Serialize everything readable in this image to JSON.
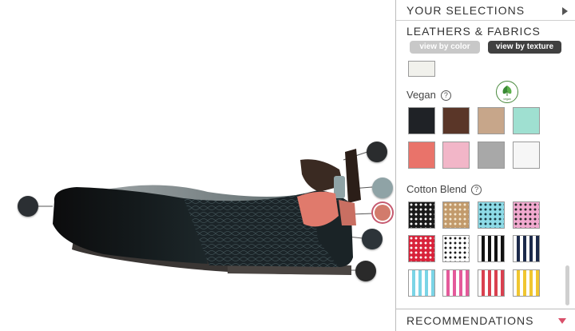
{
  "panel": {
    "selections_label": "YOUR SELECTIONS",
    "leathers_title": "LEATHERS & FABRICS",
    "view_by_color": "view by color",
    "view_by_texture": "view by texture",
    "recommendations_label": "RECOMMENDATIONS",
    "vegan_badge_label": "vegan",
    "groups": {
      "vegan": "Vegan",
      "cotton": "Cotton Blend"
    }
  },
  "hotspots": [
    {
      "name": "hotspot-toe",
      "color": "#2b2f33"
    },
    {
      "name": "hotspot-bow-top",
      "color": "#2a2c2e"
    },
    {
      "name": "hotspot-bow-band",
      "color": "#8fa3a6"
    },
    {
      "name": "hotspot-bow-lining",
      "color": "#d27b6c"
    },
    {
      "name": "hotspot-heel-counter",
      "color": "#2d3439"
    },
    {
      "name": "hotspot-sole",
      "color": "#2a2a2a"
    }
  ],
  "swatches": {
    "partial_top": {
      "color": "#f1f1ec"
    },
    "vegan": [
      "#1f2226",
      "#5a3628",
      "#c7a68a",
      "#9fe0d1",
      "#e9736a",
      "#f2b6c8",
      "#a8a8a8",
      "#f6f6f6"
    ],
    "cotton": [
      {
        "pattern": "dots",
        "base": "#1a1a1a",
        "dot": "#ffffff"
      },
      {
        "pattern": "dots",
        "base": "#c29a6b",
        "dot": "#f4e8d2"
      },
      {
        "pattern": "dots",
        "base": "#8ddbe7",
        "dot": "#1a3a44"
      },
      {
        "pattern": "dots",
        "base": "#f1a9cf",
        "dot": "#2a2a2a"
      },
      {
        "pattern": "dots",
        "base": "#d8223a",
        "dot": "#ffffff"
      },
      {
        "pattern": "dots",
        "base": "#ffffff",
        "dot": "#1a1a1a"
      },
      {
        "pattern": "stripes",
        "a": "#ffffff",
        "b": "#111111"
      },
      {
        "pattern": "stripes",
        "a": "#ffffff",
        "b": "#1c2a4a"
      },
      {
        "pattern": "stripes",
        "a": "#ffffff",
        "b": "#7ad4e6"
      },
      {
        "pattern": "stripes",
        "a": "#ffffff",
        "b": "#e45a9a"
      },
      {
        "pattern": "stripes",
        "a": "#ffffff",
        "b": "#d9404f"
      },
      {
        "pattern": "stripes",
        "a": "#ffffff",
        "b": "#f0c630"
      }
    ]
  }
}
